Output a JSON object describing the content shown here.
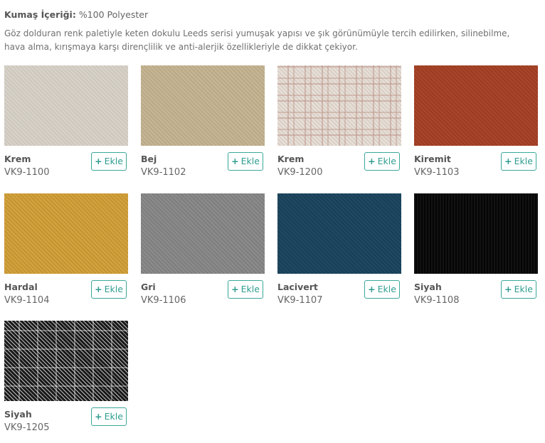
{
  "content": {
    "label": "Kumaş İçeriği:",
    "value": "%100 Polyester"
  },
  "description": "Göz dolduran renk paletiyle keten dokulu Leeds serisi yumuşak yapısı ve şık görünümüyle tercih edilirken, silinebilme, hava alma, kırışmaya karşı dirençlilik ve anti-alerjik özellikleriyle de dikkat çekiyor.",
  "add_plus": "+",
  "add_label": "Ekle",
  "fabrics": [
    {
      "name": "Krem",
      "code": "VK9-1100",
      "color": "#d4cfc6"
    },
    {
      "name": "Bej",
      "code": "VK9-1102",
      "color": "#c0b08f"
    },
    {
      "name": "Krem",
      "code": "VK9-1200",
      "color": "#e2dad2"
    },
    {
      "name": "Kiremit",
      "code": "VK9-1103",
      "color": "#a24128"
    },
    {
      "name": "Hardal",
      "code": "VK9-1104",
      "color": "#cc9c39"
    },
    {
      "name": "Gri",
      "code": "VK9-1106",
      "color": "#858585"
    },
    {
      "name": "Lacivert",
      "code": "VK9-1107",
      "color": "#1d445c"
    },
    {
      "name": "Siyah",
      "code": "VK9-1108",
      "color": "#0b0b0b"
    },
    {
      "name": "Siyah",
      "code": "VK9-1205",
      "color": "#3a3a3a"
    }
  ]
}
